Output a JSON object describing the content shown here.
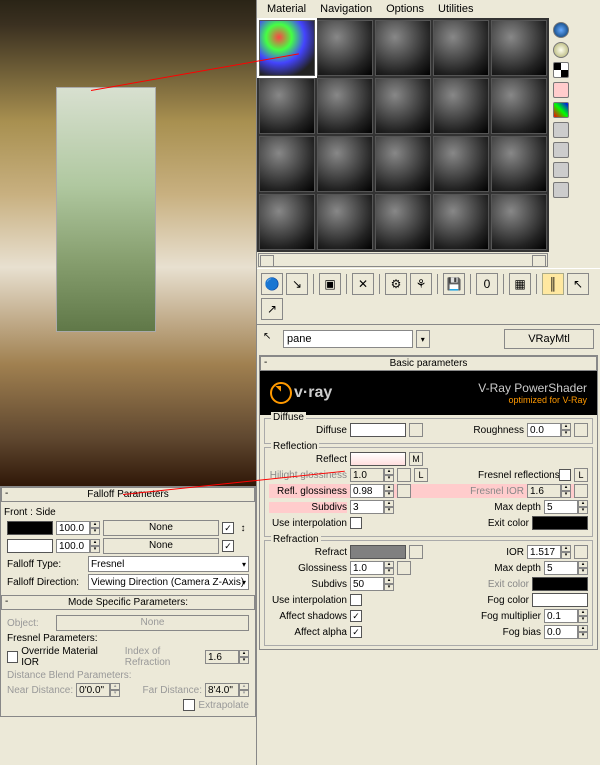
{
  "menu": {
    "material": "Material",
    "navigation": "Navigation",
    "options": "Options",
    "utilities": "Utilities"
  },
  "scrollbar": {
    "left": "◄",
    "right": "►"
  },
  "sideIcons": [
    "globe-icon",
    "phase-icon",
    "checker-bg-icon",
    "backlight-icon",
    "palette-icon",
    "film-icon",
    "video-icon",
    "settings-icon",
    "eyedrop-icon"
  ],
  "toolbar": {
    "btns": [
      "get-material",
      "put-to-scene",
      "assign",
      "reset",
      "delete",
      "make-unique",
      "put-to-lib",
      "material-id",
      "show-map",
      "show-end",
      "go-parent",
      "go-forward",
      "options",
      "pick-list"
    ]
  },
  "material": {
    "name": "pane",
    "type": "VRayMtl"
  },
  "panel": {
    "title": "Basic parameters",
    "minus": "-"
  },
  "vray": {
    "title": "V-Ray PowerShader",
    "sub": "optimized for V-Ray",
    "brand": "v·ray"
  },
  "diffuse": {
    "legend": "Diffuse",
    "label": "Diffuse",
    "rough_label": "Roughness",
    "rough": "0.0"
  },
  "reflection": {
    "legend": "Reflection",
    "reflect": "Reflect",
    "mapM": "M",
    "hilight": "Hilight glossiness",
    "hilight_v": "1.0",
    "reflgloss": "Refl. glossiness",
    "reflgloss_v": "0.98",
    "subdivs": "Subdivs",
    "subdivs_v": "3",
    "useinterp": "Use interpolation",
    "lockL": "L",
    "fresnel": "Fresnel reflections",
    "fresnelior": "Fresnel IOR",
    "fresnelior_v": "1.6",
    "maxdepth": "Max depth",
    "maxdepth_v": "5",
    "exit": "Exit color"
  },
  "refraction": {
    "legend": "Refraction",
    "refract": "Refract",
    "gloss": "Glossiness",
    "gloss_v": "1.0",
    "subdivs": "Subdivs",
    "subdivs_v": "50",
    "useinterp": "Use interpolation",
    "affectshadows": "Affect shadows",
    "affectalpha": "Affect alpha",
    "ior": "IOR",
    "ior_v": "1.517",
    "maxdepth": "Max depth",
    "maxdepth_v": "5",
    "exit": "Exit color",
    "fog": "Fog color",
    "fogmult": "Fog multiplier",
    "fogmult_v": "0.1",
    "fogbias": "Fog bias",
    "fogbias_v": "0.0"
  },
  "falloff": {
    "title": "Falloff Parameters",
    "frontside": "Front : Side",
    "val1": "100.0",
    "val2": "100.0",
    "none": "None",
    "swapTip": "↕ ",
    "type_l": "Falloff Type:",
    "type_v": "Fresnel",
    "dir_l": "Falloff Direction:",
    "dir_v": "Viewing Direction (Camera Z-Axis)",
    "mode_title": "Mode Specific Parameters:",
    "object": "Object:",
    "object_none": "None",
    "fresparam": "Fresnel Parameters:",
    "override": "Override Material IOR",
    "ior_l": "Index of Refraction",
    "ior_v": "1.6",
    "dist_title": "Distance Blend Parameters:",
    "near_l": "Near Distance:",
    "near_v": "0'0.0\"",
    "far_l": "Far Distance:",
    "far_v": "8'4.0\"",
    "extrapolate": "Extrapolate"
  }
}
